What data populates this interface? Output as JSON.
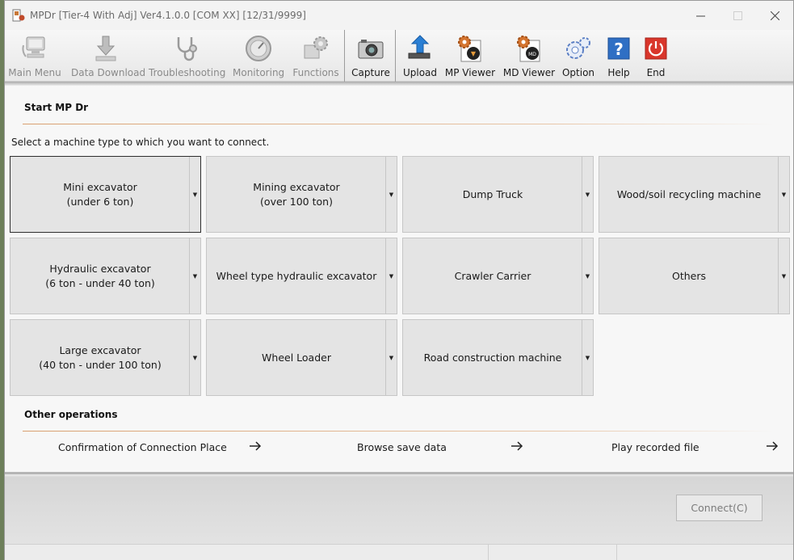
{
  "window": {
    "title": "MPDr [Tier-4 With Adj] Ver4.1.0.0 [COM XX] [12/31/9999]"
  },
  "toolbar": {
    "items": [
      {
        "label": "Main Menu",
        "icon": "computer-icon",
        "enabled": false
      },
      {
        "label": "Data Download",
        "icon": "download-icon",
        "enabled": false
      },
      {
        "label": "Troubleshooting",
        "icon": "stethoscope-icon",
        "enabled": false
      },
      {
        "label": "Monitoring",
        "icon": "gauge-icon",
        "enabled": false
      },
      {
        "label": "Functions",
        "icon": "gears-icon",
        "enabled": false
      },
      {
        "label": "Capture",
        "icon": "camera-icon",
        "enabled": true
      },
      {
        "label": "Upload",
        "icon": "upload-icon",
        "enabled": true
      },
      {
        "label": "MP Viewer",
        "icon": "mp-viewer-icon",
        "enabled": true
      },
      {
        "label": "MD Viewer",
        "icon": "md-viewer-icon",
        "enabled": true
      },
      {
        "label": "Option",
        "icon": "option-gear-icon",
        "enabled": true
      },
      {
        "label": "Help",
        "icon": "help-icon",
        "enabled": true
      },
      {
        "label": "End",
        "icon": "power-icon",
        "enabled": true
      }
    ]
  },
  "start": {
    "title": "Start MP Dr",
    "instruction": "Select a machine type to which you want to connect."
  },
  "machines": [
    {
      "label": "Mini excavator\n(under 6 ton)",
      "selected": true
    },
    {
      "label": "Mining excavator\n(over 100 ton)",
      "selected": false
    },
    {
      "label": "Dump Truck",
      "selected": false
    },
    {
      "label": "Wood/soil recycling machine",
      "selected": false
    },
    {
      "label": "Hydraulic excavator\n(6 ton - under 40 ton)",
      "selected": false
    },
    {
      "label": "Wheel type hydraulic excavator",
      "selected": false
    },
    {
      "label": "Crawler Carrier",
      "selected": false
    },
    {
      "label": "Others",
      "selected": false
    },
    {
      "label": "Large excavator\n(40 ton - under 100 ton)",
      "selected": false
    },
    {
      "label": "Wheel Loader",
      "selected": false
    },
    {
      "label": "Road construction machine",
      "selected": false
    }
  ],
  "other_operations": {
    "title": "Other operations",
    "links": [
      {
        "label": "Confirmation of Connection Place"
      },
      {
        "label": "Browse save data"
      },
      {
        "label": "Play recorded file"
      }
    ]
  },
  "footer": {
    "connect_label": "Connect(C)",
    "connect_enabled": false
  },
  "colors": {
    "accent_rule": "#d9a070",
    "end_red": "#d9362b",
    "help_blue": "#2f6fc4"
  }
}
